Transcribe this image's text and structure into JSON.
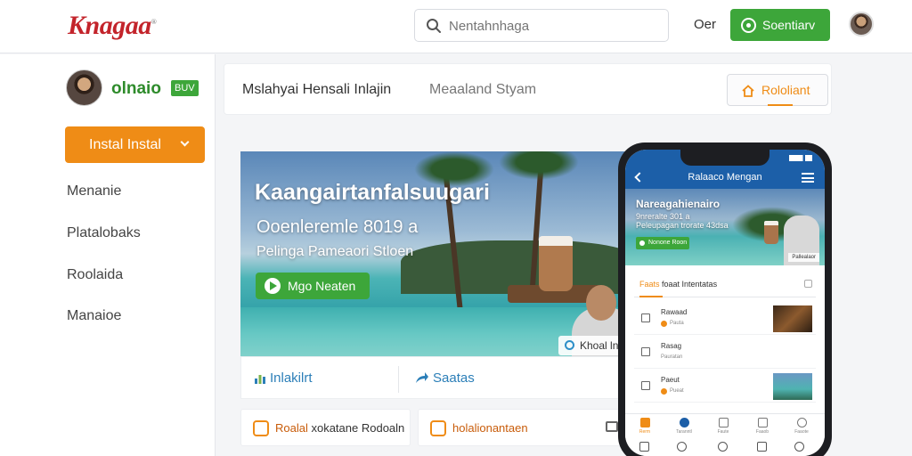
{
  "header": {
    "logo": "Knagaa",
    "logo_mark": "®",
    "search": {
      "placeholder": "Nentahnhaga",
      "value": ""
    },
    "link_label": "Oer",
    "cta_label": "Soentiarv",
    "icons": {
      "search": "search-icon",
      "cta": "circle-dot-icon",
      "avatar": "user-avatar"
    }
  },
  "sidebar": {
    "profile_name": "olnaio",
    "profile_badge": "BUV",
    "install_label": "Instal Instal",
    "items": [
      {
        "label": "Menanie"
      },
      {
        "label": "Platalobaks"
      },
      {
        "label": "Roolaida"
      },
      {
        "label": "Manaioe"
      }
    ]
  },
  "main": {
    "tabs": [
      {
        "label": "Mslahyai Hensali Inlajin"
      },
      {
        "label": "Meaaland Styam"
      }
    ],
    "action_button_label": "Rololiant",
    "hero": {
      "title": "Kaangairtanfalsuugari",
      "subtitle": "Ooenleremle 8019 a",
      "subtitle2": "Pelinga Pameaori Stloen",
      "button_label": "Mgo Neaten",
      "chip_label": "Khoal ln"
    },
    "actions": [
      {
        "label": "Inlakilrt"
      },
      {
        "label": "Saatas"
      }
    ],
    "cards": [
      {
        "label_highlight": "Roalal",
        "label_rest": " xokatane Rodoaln"
      },
      {
        "label": "holalionantaen"
      }
    ]
  },
  "phone": {
    "app_title": "Ralaaco Mengan",
    "hero_title": "Nareagahienairo",
    "hero_subtitle": "9nreralte 301 a",
    "hero_subtitle2": "Peleupagan trorate 43dsa",
    "hero_button": "Nonone Roon",
    "hero_chip": "Pallealaor",
    "section_highlight": "Faats",
    "section_rest": " foaat Intentatas",
    "rows": [
      {
        "title": "Rawaad",
        "sub": "Pauta"
      },
      {
        "title": "Rasag",
        "sub": "Pauratan"
      },
      {
        "title": "Paeut",
        "sub": "Pueat"
      }
    ],
    "tabs": [
      {
        "label": "Rerm"
      },
      {
        "label": "Taranntl"
      },
      {
        "label": "Faute"
      },
      {
        "label": "Faaob"
      },
      {
        "label": "Faaote"
      }
    ]
  },
  "colors": {
    "brand": "#c3242b",
    "primary_green": "#3da63a",
    "accent_orange": "#ef8c16",
    "link_blue": "#2c7fb8",
    "phone_bar": "#1c5fa8"
  }
}
